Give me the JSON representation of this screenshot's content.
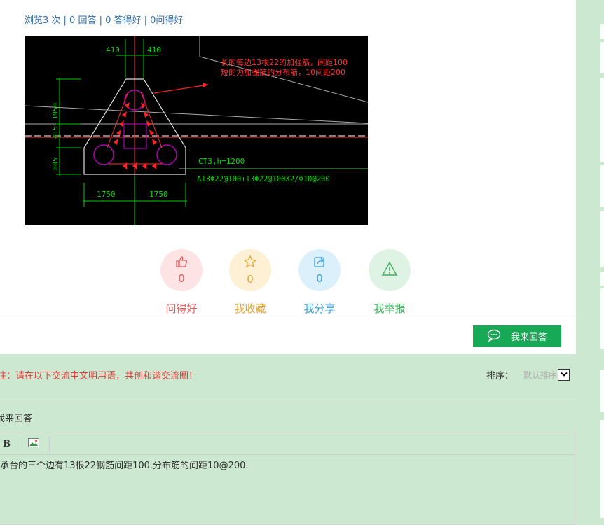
{
  "stats": {
    "text": "浏览3 次 | 0 回答 | 0 答得好 | 0问得好"
  },
  "drawing": {
    "dim_top_left": "410",
    "dim_top_right": "410",
    "note_line1": "长的每边13根22的加强筋，间距100",
    "note_line2": "短的为加强筋的分布筋，10间距200",
    "dim_left_1": "1950",
    "dim_left_2": "415",
    "dim_left_3": "805",
    "label_ct3": "CT3,h=1200",
    "label_rebar": "Δ13Φ22@100+13Φ22@100X2/Φ10@200",
    "dim_bottom_left": "1750",
    "dim_bottom_right": "1750"
  },
  "actions": [
    {
      "label": "问得好",
      "count": "0",
      "icon": "thumbs-up-icon",
      "color": "#e05a5a",
      "bg": "#fde3e3"
    },
    {
      "label": "我收藏",
      "count": "0",
      "icon": "star-icon",
      "color": "#e0a431",
      "bg": "#fdf0d5"
    },
    {
      "label": "我分享",
      "count": "0",
      "icon": "share-icon",
      "color": "#3a9fd6",
      "bg": "#dcf0fb"
    },
    {
      "label": "我举报",
      "count": "0",
      "icon": "warning-icon",
      "color": "#3fb05d",
      "bg": "#def3e3"
    }
  ],
  "answer_button": {
    "label": "我来回答"
  },
  "notice": "注：请在以下交流中文明用语，共创和谐交流圈！",
  "sort": {
    "label": "排序：",
    "selected": "默认排序"
  },
  "my_answer_label": "我来回答",
  "editor": {
    "bold_label": "B",
    "content": "承台的三个边有13根22钢筋间距100.分布筋的间距10@200."
  }
}
